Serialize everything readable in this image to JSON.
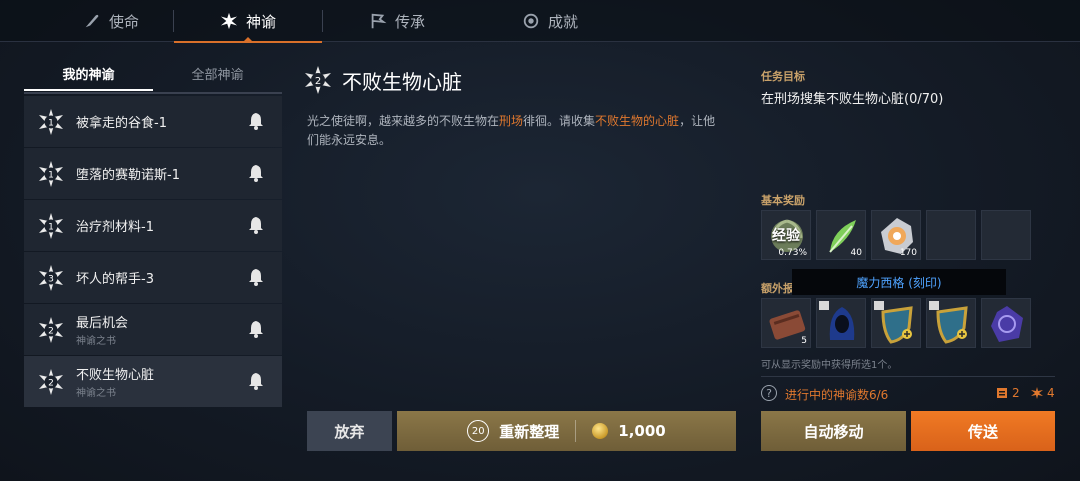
{
  "top_tabs": [
    {
      "label": "使命",
      "icon": "quill-icon"
    },
    {
      "label": "神谕",
      "icon": "star-burst-icon"
    },
    {
      "label": "传承",
      "icon": "flag-icon"
    },
    {
      "label": "成就",
      "icon": "medal-icon"
    }
  ],
  "sub_tabs": {
    "mine": "我的神谕",
    "all": "全部神谕"
  },
  "quests": [
    {
      "badge": "1",
      "title": "被拿走的谷食-1",
      "subtitle": ""
    },
    {
      "badge": "1",
      "title": "堕落的赛勒诺斯-1",
      "subtitle": ""
    },
    {
      "badge": "1",
      "title": "治疗剂材料-1",
      "subtitle": ""
    },
    {
      "badge": "3",
      "title": "坏人的帮手-3",
      "subtitle": ""
    },
    {
      "badge": "2",
      "title": "最后机会",
      "subtitle": "神谕之书"
    },
    {
      "badge": "2",
      "title": "不败生物心脏",
      "subtitle": "神谕之书"
    }
  ],
  "detail": {
    "badge": "2",
    "title": "不败生物心脏",
    "desc_1": "光之使徒啊，越来越多的不败生物在",
    "desc_hl_1": "刑场",
    "desc_2": "徘徊。请收集",
    "desc_hl_2": "不败生物的心脏",
    "desc_3": "，让他们能永远安息。"
  },
  "right": {
    "goal_label": "任务目标",
    "goal_text": "在刑场搜集不败生物心脏(0/70)",
    "basic_reward_label": "基本奖励",
    "basic_rewards": [
      {
        "icon": "exp-laurel-icon",
        "overlay": "经验",
        "count": "0.73%"
      },
      {
        "icon": "green-leaf-icon",
        "count": "40"
      },
      {
        "icon": "silver-coin-icon",
        "count": "170"
      },
      {
        "icon": "empty-slot",
        "count": ""
      },
      {
        "icon": "empty-slot",
        "count": ""
      }
    ],
    "extra_reward_label": "额外报",
    "tooltip": "魔力西格 (刻印)",
    "extra_rewards": [
      {
        "icon": "scroll-bundle-icon",
        "count": "5",
        "book": false
      },
      {
        "icon": "blue-hood-icon",
        "count": "",
        "book": true
      },
      {
        "icon": "gold-shield-icon",
        "count": "",
        "book": true
      },
      {
        "icon": "gold-shield-icon",
        "count": "",
        "book": true
      },
      {
        "icon": "purple-crystal-icon",
        "count": "",
        "book": false
      }
    ],
    "note": "可从显示奖励中获得所选1个。",
    "help": "?",
    "progress": "进行中的神谕数6/6",
    "count_a": "2",
    "count_b": "4"
  },
  "buttons": {
    "abandon": "放弃",
    "reorg_badge": "20",
    "reorg": "重新整理",
    "reorg_cost": "1,000",
    "auto_move": "自动移动",
    "teleport": "传送"
  },
  "colors": {
    "accent": "#e0782e",
    "gold_button": "#8b7748",
    "orange_button": "#f07a24",
    "tooltip_text": "#4fa3ff"
  }
}
